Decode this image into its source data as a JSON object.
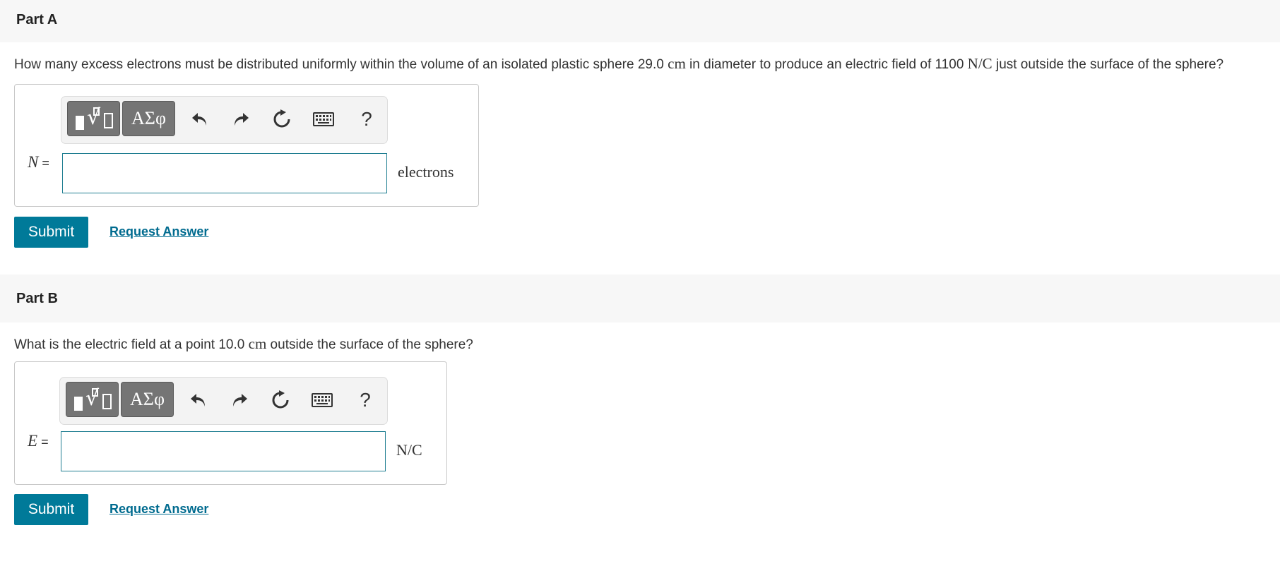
{
  "part_a": {
    "title": "Part A",
    "question_pre": "How many excess electrons must be distributed uniformly within the volume of an isolated plastic sphere 29.0 ",
    "question_unit1": "cm",
    "question_mid": " in diameter to produce an electric field of 1100 ",
    "question_unit2": "N/C",
    "question_post": " just outside the surface of the sphere?",
    "variable": "N",
    "equals": " =",
    "input_value": "",
    "unit": "electrons",
    "submit_label": "Submit",
    "request_label": "Request Answer"
  },
  "part_b": {
    "title": "Part B",
    "question_pre": "What is the electric field at a point 10.0 ",
    "question_unit1": "cm",
    "question_post": " outside the surface of the sphere?",
    "variable": "E",
    "equals": " =",
    "input_value": "",
    "unit": "N/C",
    "submit_label": "Submit",
    "request_label": "Request Answer"
  },
  "toolbar": {
    "templates_icon": "templates-icon",
    "greek_label": "ΑΣφ",
    "undo_icon": "undo-icon",
    "redo_icon": "redo-icon",
    "reset_icon": "reset-icon",
    "keyboard_icon": "keyboard-icon",
    "help_label": "?"
  },
  "colors": {
    "accent": "#007a99",
    "link": "#006b8f",
    "input_border": "#1f7e91",
    "toolbar_button": "#757575",
    "header_bg": "#f7f7f7"
  }
}
